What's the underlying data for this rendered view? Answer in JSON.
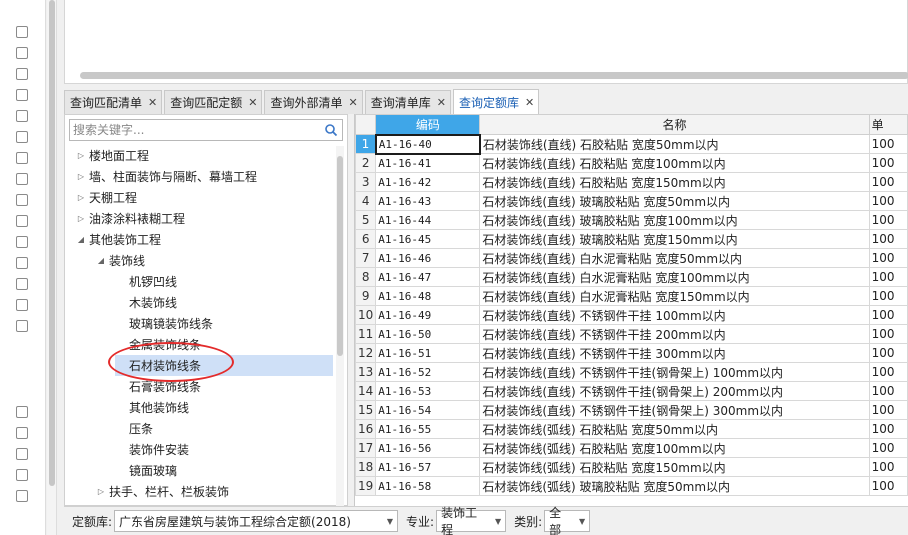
{
  "tabs": [
    {
      "label": "查询匹配清单",
      "active": false
    },
    {
      "label": "查询匹配定额",
      "active": false
    },
    {
      "label": "查询外部清单",
      "active": false
    },
    {
      "label": "查询清单库",
      "active": false
    },
    {
      "label": "查询定额库",
      "active": true
    }
  ],
  "search": {
    "placeholder": "搜索关键字..."
  },
  "tree": [
    {
      "label": "楼地面工程",
      "level": 0,
      "expanded": false
    },
    {
      "label": "墙、柱面装饰与隔断、幕墙工程",
      "level": 0,
      "expanded": false
    },
    {
      "label": "天棚工程",
      "level": 0,
      "expanded": false
    },
    {
      "label": "油漆涂料裱糊工程",
      "level": 0,
      "expanded": false
    },
    {
      "label": "其他装饰工程",
      "level": 0,
      "expanded": true
    },
    {
      "label": "装饰线",
      "level": 1,
      "expanded": true
    },
    {
      "label": "机锣凹线",
      "level": 2
    },
    {
      "label": "木装饰线",
      "level": 2
    },
    {
      "label": "玻璃镜装饰线条",
      "level": 2
    },
    {
      "label": "金属装饰线条",
      "level": 2
    },
    {
      "label": "石材装饰线条",
      "level": 2,
      "selected": true
    },
    {
      "label": "石膏装饰线条",
      "level": 2
    },
    {
      "label": "其他装饰线",
      "level": 2
    },
    {
      "label": "压条",
      "level": 2
    },
    {
      "label": "装饰件安装",
      "level": 2
    },
    {
      "label": "镜面玻璃",
      "level": 2
    },
    {
      "label": "扶手、栏杆、栏板装饰",
      "level": 1,
      "expanded": false
    }
  ],
  "grid": {
    "headers": {
      "code": "编码",
      "name": "名称",
      "unit": "单"
    },
    "rows": [
      {
        "n": "1",
        "code": "A1-16-40",
        "name": "石材装饰线(直线) 石胶粘贴 宽度50mm以内",
        "unit": "100"
      },
      {
        "n": "2",
        "code": "A1-16-41",
        "name": "石材装饰线(直线) 石胶粘贴 宽度100mm以内",
        "unit": "100"
      },
      {
        "n": "3",
        "code": "A1-16-42",
        "name": "石材装饰线(直线) 石胶粘贴 宽度150mm以内",
        "unit": "100"
      },
      {
        "n": "4",
        "code": "A1-16-43",
        "name": "石材装饰线(直线) 玻璃胶粘贴 宽度50mm以内",
        "unit": "100"
      },
      {
        "n": "5",
        "code": "A1-16-44",
        "name": "石材装饰线(直线) 玻璃胶粘贴 宽度100mm以内",
        "unit": "100"
      },
      {
        "n": "6",
        "code": "A1-16-45",
        "name": "石材装饰线(直线) 玻璃胶粘贴 宽度150mm以内",
        "unit": "100"
      },
      {
        "n": "7",
        "code": "A1-16-46",
        "name": "石材装饰线(直线) 白水泥膏粘贴 宽度50mm以内",
        "unit": "100"
      },
      {
        "n": "8",
        "code": "A1-16-47",
        "name": "石材装饰线(直线) 白水泥膏粘贴 宽度100mm以内",
        "unit": "100"
      },
      {
        "n": "9",
        "code": "A1-16-48",
        "name": "石材装饰线(直线) 白水泥膏粘贴 宽度150mm以内",
        "unit": "100"
      },
      {
        "n": "10",
        "code": "A1-16-49",
        "name": "石材装饰线(直线) 不锈钢件干挂 100mm以内",
        "unit": "100"
      },
      {
        "n": "11",
        "code": "A1-16-50",
        "name": "石材装饰线(直线) 不锈钢件干挂 200mm以内",
        "unit": "100"
      },
      {
        "n": "12",
        "code": "A1-16-51",
        "name": "石材装饰线(直线) 不锈钢件干挂 300mm以内",
        "unit": "100"
      },
      {
        "n": "13",
        "code": "A1-16-52",
        "name": "石材装饰线(直线) 不锈钢件干挂(钢骨架上) 100mm以内",
        "unit": "100"
      },
      {
        "n": "14",
        "code": "A1-16-53",
        "name": "石材装饰线(直线) 不锈钢件干挂(钢骨架上) 200mm以内",
        "unit": "100"
      },
      {
        "n": "15",
        "code": "A1-16-54",
        "name": "石材装饰线(直线) 不锈钢件干挂(钢骨架上) 300mm以内",
        "unit": "100"
      },
      {
        "n": "16",
        "code": "A1-16-55",
        "name": "石材装饰线(弧线) 石胶粘贴 宽度50mm以内",
        "unit": "100"
      },
      {
        "n": "17",
        "code": "A1-16-56",
        "name": "石材装饰线(弧线) 石胶粘贴 宽度100mm以内",
        "unit": "100"
      },
      {
        "n": "18",
        "code": "A1-16-57",
        "name": "石材装饰线(弧线) 石胶粘贴 宽度150mm以内",
        "unit": "100"
      },
      {
        "n": "19",
        "code": "A1-16-58",
        "name": "石材装饰线(弧线) 玻璃胶粘贴 宽度50mm以内",
        "unit": "100"
      }
    ]
  },
  "status": {
    "library_label": "定额库:",
    "library_value": "广东省房屋建筑与装饰工程综合定额(2018)",
    "specialty_label": "专业:",
    "specialty_value": "装饰工程",
    "category_label": "类别:",
    "category_value": "全部"
  },
  "colors": {
    "accent": "#3fa6e8",
    "selection": "#cfe0f7",
    "annotation": "#e32b2b"
  }
}
